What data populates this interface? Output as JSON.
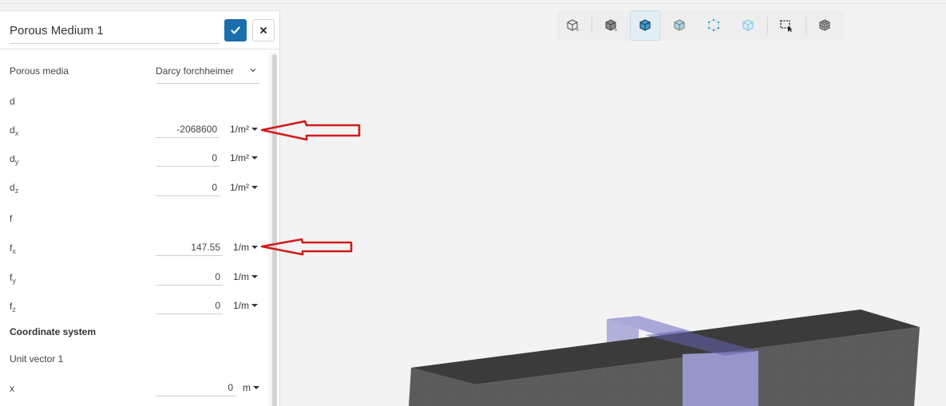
{
  "panel": {
    "title": "Porous Medium 1",
    "confirm_icon": "check-icon",
    "close_icon": "close-icon",
    "accent": "#1a6eab",
    "porous_media": {
      "label": "Porous media",
      "value": "Darcy forchheimer"
    },
    "d_label": "d",
    "dx": {
      "label": "d",
      "sub": "x",
      "value": "-2068600",
      "unit": "1/m²"
    },
    "dy": {
      "label": "d",
      "sub": "y",
      "value": "0",
      "unit": "1/m²"
    },
    "dz": {
      "label": "d",
      "sub": "z",
      "value": "0",
      "unit": "1/m²"
    },
    "f_label": "f",
    "fx": {
      "label": "f",
      "sub": "x",
      "value": "147.55",
      "unit": "1/m"
    },
    "fy": {
      "label": "f",
      "sub": "y",
      "value": "0",
      "unit": "1/m"
    },
    "fz": {
      "label": "f",
      "sub": "z",
      "value": "0",
      "unit": "1/m"
    },
    "coordinate_system": "Coordinate system",
    "unit_vector_1": "Unit vector 1",
    "x": {
      "label": "x",
      "value": "0",
      "unit": "m"
    }
  },
  "toolbar": {
    "buttons": [
      "cube-outline-icon",
      "cube-solid-icon",
      "cube-selected-icon",
      "cube-faces-icon",
      "cube-vertices-icon",
      "cube-transparent-icon",
      "box-select-icon",
      "mesh-cube-icon"
    ],
    "active_button": "cube-selected-icon"
  },
  "annotations": {
    "arrow_color": "#d01c1c",
    "arrows": [
      "arrow-to-dx-unit",
      "arrow-to-fx-unit"
    ]
  },
  "scene": {
    "beam_color": "#3a3a3a",
    "porous_zone_color": "#8f8fc8"
  }
}
